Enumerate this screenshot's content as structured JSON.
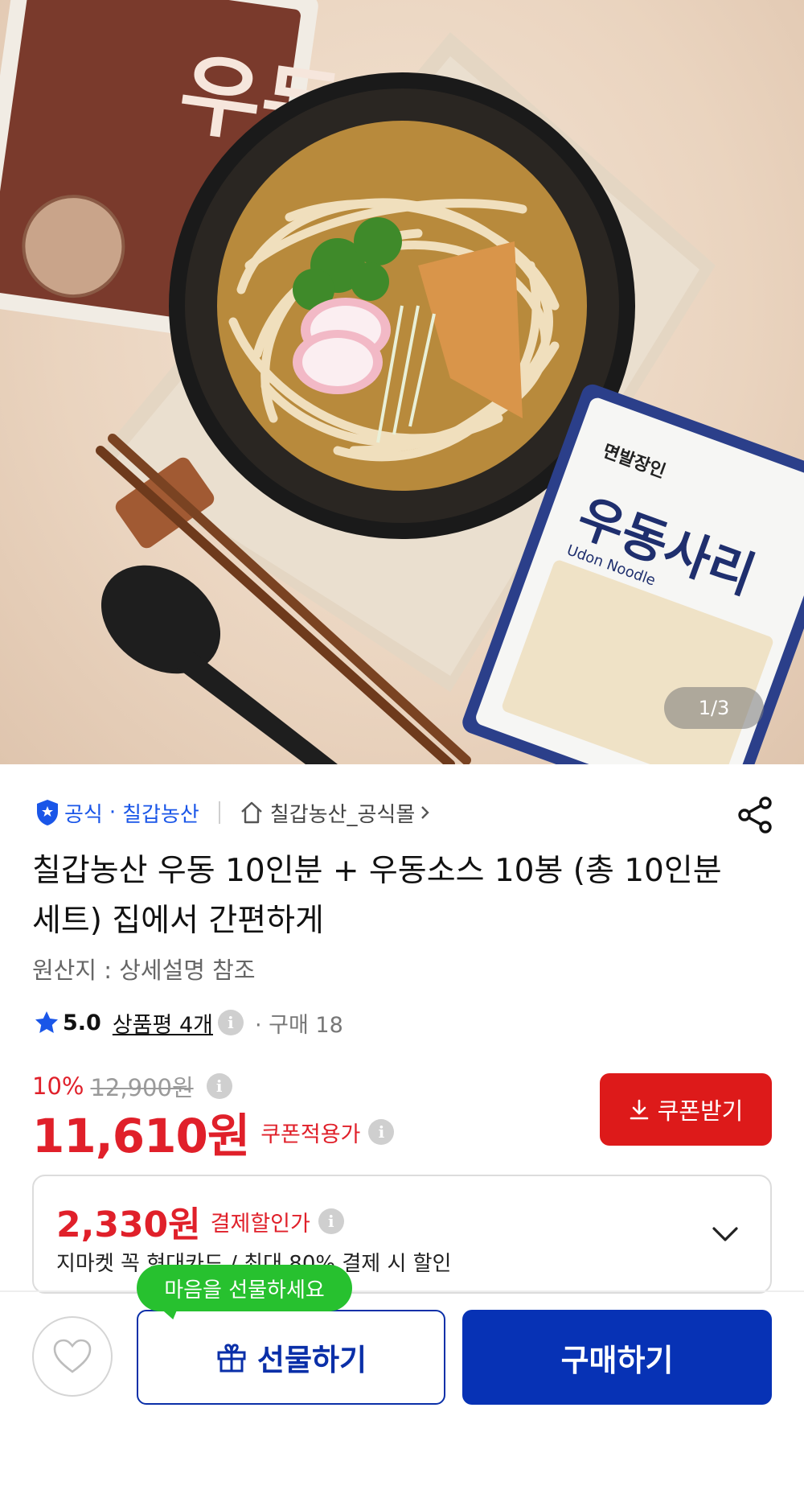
{
  "image": {
    "counter": "1/3",
    "left_pack_text": "우동",
    "right_pack_brand": "면발장인",
    "right_pack_title": "우동사리",
    "right_pack_sub": "Udon Noodle"
  },
  "seller": {
    "official": "공식",
    "dot": "·",
    "name": "칠갑농산",
    "store_link": "칠갑농산_공식몰"
  },
  "product": {
    "title": "칠갑농산 우동 10인분 + 우동소스 10봉 (총 10인분 세트) 집에서 간편하게",
    "origin": "원산지 : 상세설명 참조"
  },
  "rating": {
    "score": "5.0",
    "reviews": "상품평 4개",
    "purchase": "· 구매 18"
  },
  "price": {
    "discount_rate": "10%",
    "original": "12,900원",
    "sale": "11,610원",
    "coupon_applied_label": "쿠폰적용가",
    "coupon_button": "쿠폰받기"
  },
  "payment": {
    "price": "2,330원",
    "label": "결제할인가",
    "description": "지마켓 꼭 현대카드 / 최대 80% 결제 시 할인"
  },
  "bottom_bar": {
    "gift_tooltip": "마음을 선물하세요",
    "gift_button": "선물하기",
    "buy_button": "구매하기"
  },
  "colors": {
    "brand_blue": "#0732b5",
    "link_blue": "#1a56e8",
    "price_red": "#e0202a",
    "coupon_red": "#dd1a1a",
    "tooltip_green": "#27c12f"
  },
  "icons": [
    "shield-badge-icon",
    "home-icon",
    "chevron-right-icon",
    "share-icon",
    "star-icon",
    "info-icon",
    "download-icon",
    "chevron-down-icon",
    "heart-icon",
    "gift-icon"
  ]
}
